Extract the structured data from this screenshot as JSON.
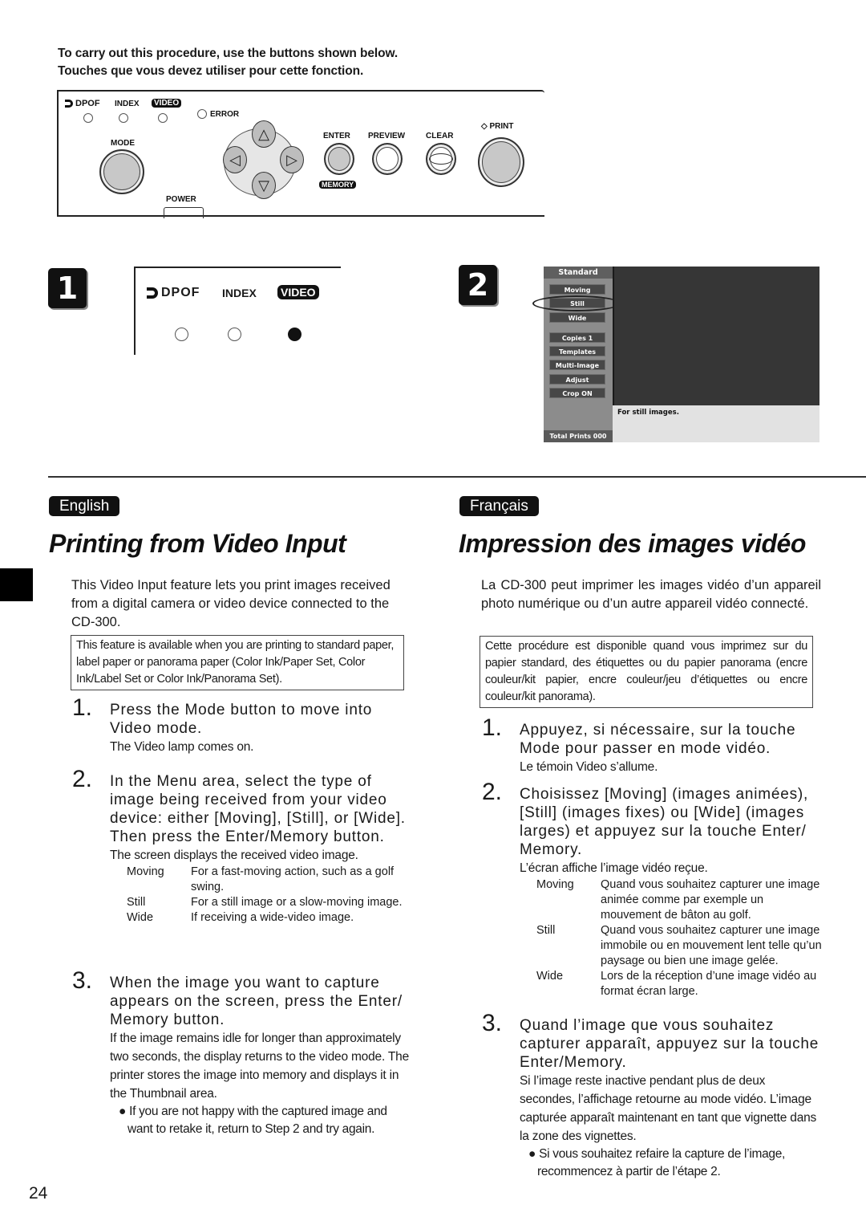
{
  "intro": {
    "line_en": "To carry out this procedure, use the buttons shown below.",
    "line_fr": "Touches que vous devez utiliser pour cette fonction."
  },
  "control_panel": {
    "dpof_label": "DPOF",
    "index_label": "INDEX",
    "video_label": "VIDEO",
    "error_label": "ERROR",
    "mode_label": "MODE",
    "power_label": "POWER",
    "enter_label": "ENTER",
    "memory_label": "MEMORY",
    "preview_label": "PREVIEW",
    "clear_label": "CLEAR",
    "print_label": "PRINT",
    "print_icon": "◇",
    "up_icon": "△",
    "down_icon": "▽",
    "left_icon": "◁",
    "right_icon": "▷"
  },
  "step1_figure": {
    "badge": "1",
    "dpof_label": "DPOF",
    "index_label": "INDEX",
    "video_label": "VIDEO",
    "lamps": [
      "off",
      "off",
      "on"
    ]
  },
  "step2_figure": {
    "badge": "2",
    "sidebar_title": "Standard",
    "menu_items": [
      "Moving",
      "Still",
      "Wide",
      "Copies   1",
      "Templates",
      "Multi-Image",
      "Adjust",
      "Crop ON"
    ],
    "highlighted_item": "Still",
    "status_text": "For still images.",
    "total_prints_label": "Total Prints  000"
  },
  "english": {
    "lang_tag": "English",
    "title": "Printing from Video Input",
    "intro": "This Video Input feature lets you print images received from a digital camera or video device connected to the CD-300.",
    "note": "This feature is available when you are printing to standard paper, label paper or panorama paper (Color Ink/Paper Set, Color Ink/Label Set or Color Ink/Panorama Set).",
    "steps": [
      {
        "num": "1.",
        "text": "Press the Mode button to move into Video mode.",
        "sub": "The Video lamp comes on."
      },
      {
        "num": "2.",
        "text": "In the Menu area, select the type of image being received from your video device: either [Moving], [Still], or [Wide]. Then press the Enter/Memory button.",
        "sub": "The screen displays the received video image."
      },
      {
        "num": "3.",
        "text": "When the image you want to capture appears on the screen, press the Enter/ Memory button.",
        "sub": "If the image remains idle for longer than approximately two seconds, the display returns to the video mode. The printer stores the image into memory and displays it in the Thumbnail area."
      }
    ],
    "definitions": [
      {
        "term": "Moving",
        "desc": "For a fast-moving action, such as a golf swing."
      },
      {
        "term": "Still",
        "desc": "For a still image or a slow-moving image."
      },
      {
        "term": "Wide",
        "desc": "If receiving a wide-video image."
      }
    ],
    "bullet": "● If you are not happy with the captured image and want to retake it, return to Step 2 and try again."
  },
  "french": {
    "lang_tag": "Français",
    "title": "Impression des images vidéo",
    "intro": "La CD-300 peut imprimer les images vidéo d’un appareil photo numérique ou d’un autre appareil vidéo connecté.",
    "note": "Cette procédure est disponible quand vous imprimez sur du papier standard, des étiquettes ou du papier panorama (encre couleur/kit papier, encre couleur/jeu d’étiquettes ou encre couleur/kit panorama).",
    "steps": [
      {
        "num": "1.",
        "text": "Appuyez, si nécessaire, sur la touche Mode pour passer en mode vidéo.",
        "sub": "Le témoin Video s’allume."
      },
      {
        "num": "2.",
        "text": "Choisissez [Moving] (images animées), [Still] (images fixes) ou [Wide] (images larges) et appuyez sur la touche Enter/ Memory.",
        "sub": "L’écran affiche l’image vidéo reçue."
      },
      {
        "num": "3.",
        "text": "Quand l’image que vous souhaitez capturer apparaît, appuyez sur la touche Enter/Memory.",
        "sub": "Si l’image reste inactive pendant plus de deux secondes, l’affichage retourne au mode vidéo. L’image capturée apparaît maintenant en tant que vignette dans la zone des vignettes."
      }
    ],
    "definitions": [
      {
        "term": "Moving",
        "desc": "Quand vous souhaitez capturer une image animée comme par exemple un mouvement de bâton au golf."
      },
      {
        "term": "Still",
        "desc": "Quand vous souhaitez capturer une image immobile ou en mouvement lent telle qu’un paysage ou bien une image gelée."
      },
      {
        "term": "Wide",
        "desc": "Lors de la réception d’une image vidéo au format écran large."
      }
    ],
    "bullet": "● Si vous souhaitez refaire la capture de l’image, recommencez à partir de l’étape 2."
  },
  "page_number": "24"
}
